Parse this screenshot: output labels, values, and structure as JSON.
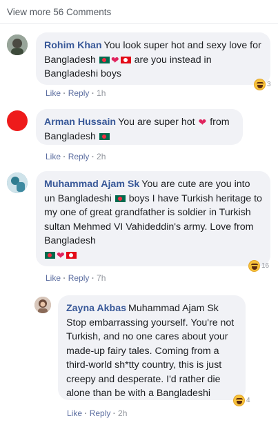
{
  "header": {
    "view_more": "View more 56 Comments"
  },
  "comments": [
    {
      "author": "Rohim Khan",
      "text_1": "You look super hot and sexy love for Bangladesh",
      "text_2": "are you instead in Bangladeshi boys",
      "like": "Like",
      "reply": "Reply",
      "time": "1h",
      "reaction_count": "3",
      "avatar_color": "#7a8a6a"
    },
    {
      "author": "Arman Hussain",
      "text_1": "You are super hot",
      "text_2": "from Bangladesh",
      "like": "Like",
      "reply": "Reply",
      "time": "2h",
      "avatar_color": "#ee1b1b"
    },
    {
      "author": "Muhammad Ajam Sk",
      "text_1": "You are cute are you into un Bangladeshi",
      "text_2": "boys I have Turkish heritage to my one of great grandfather is soldier in Turkish sultan Mehmed VI Vahideddin's army. Love from Bangladesh",
      "like": "Like",
      "reply": "Reply",
      "time": "7h",
      "reaction_count": "16",
      "avatar_color": "#6aa3b8"
    },
    {
      "author": "Zayna Akbas",
      "text_1": "Muhammad Ajam Sk Stop embarrassing yourself. You're not Turkish, and no one cares about your made-up fairy tales. Coming from a third-world sh*tty country, this is just creepy and desperate. I'd rather die alone than be with a Bangladeshi",
      "like": "Like",
      "reply": "Reply",
      "time": "2h",
      "reaction_count": "4",
      "avatar_color": "#b59a8a"
    }
  ],
  "colors": {
    "author": "#385898",
    "bubble": "#f1f2f6",
    "heart": "#e0245e"
  }
}
